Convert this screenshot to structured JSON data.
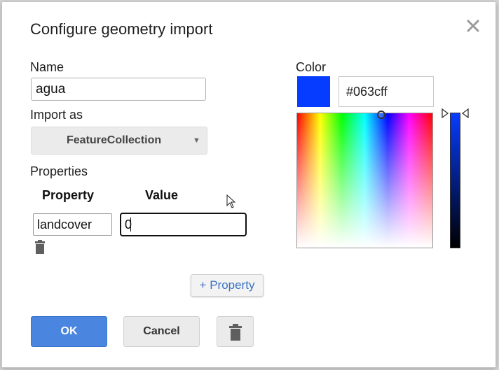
{
  "dialog": {
    "title": "Configure geometry import",
    "close_icon": "close-icon"
  },
  "name": {
    "label": "Name",
    "value": "agua"
  },
  "import_as": {
    "label": "Import as",
    "selected": "FeatureCollection"
  },
  "properties": {
    "label": "Properties",
    "col_property": "Property",
    "col_value": "Value",
    "rows": [
      {
        "property": "landcover",
        "value": "0"
      }
    ],
    "add_label": "+ Property"
  },
  "color": {
    "label": "Color",
    "hex": "#063cff",
    "swatch": "#063cff"
  },
  "buttons": {
    "ok": "OK",
    "cancel": "Cancel",
    "delete_icon": "trash-icon"
  },
  "colors": {
    "accent": "#4a86e0",
    "link": "#3b73c2"
  }
}
